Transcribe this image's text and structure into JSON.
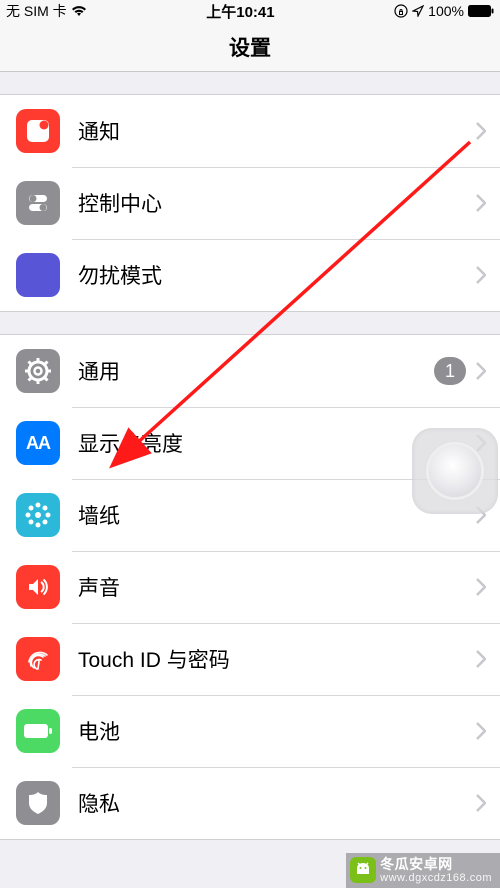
{
  "status": {
    "sim": "无 SIM 卡",
    "time": "上午10:41",
    "battery": "100%"
  },
  "nav": {
    "title": "设置"
  },
  "groups": [
    {
      "rows": [
        {
          "id": "notifications",
          "label": "通知"
        },
        {
          "id": "control-center",
          "label": "控制中心"
        },
        {
          "id": "dnd",
          "label": "勿扰模式"
        }
      ]
    },
    {
      "rows": [
        {
          "id": "general",
          "label": "通用",
          "badge": "1"
        },
        {
          "id": "display",
          "label": "显示与亮度"
        },
        {
          "id": "wallpaper",
          "label": "墙纸"
        },
        {
          "id": "sound",
          "label": "声音"
        },
        {
          "id": "touchid",
          "label": "Touch ID 与密码"
        },
        {
          "id": "battery",
          "label": "电池"
        },
        {
          "id": "privacy",
          "label": "隐私"
        }
      ]
    }
  ],
  "icon_text": {
    "display": "AA"
  },
  "watermark": {
    "brand": "冬瓜安卓网",
    "url": "www.dgxcdz168.com"
  }
}
